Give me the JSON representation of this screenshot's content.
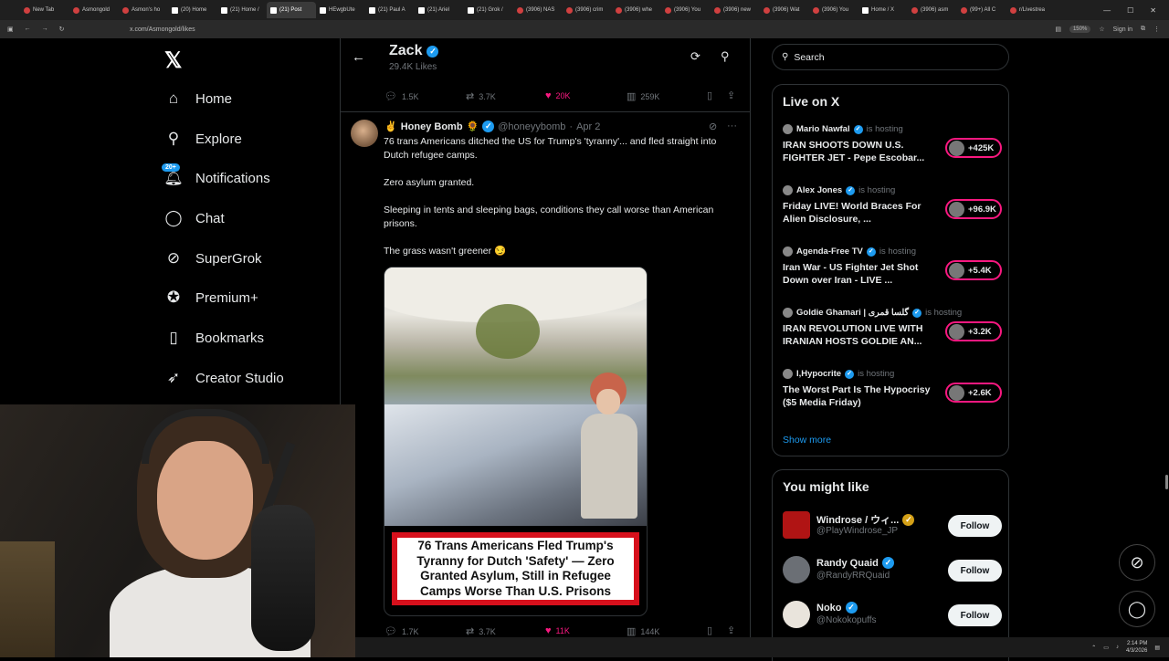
{
  "browser": {
    "tabs": [
      "New Tab",
      "Asmongold",
      "Asmon's ho",
      "(20) Home",
      "(21) Home /",
      "(21) Post",
      "HEwgbUte",
      "(21) Paul A",
      "(21) Ariel",
      "(21) Grok /",
      "(3906) NAS",
      "(3906) crim",
      "(3906) whe",
      "(3906) You",
      "(3906) new",
      "(3906) Wat",
      "(3906) You",
      "Home / X",
      "(3906) asm",
      "(99+) All C",
      "r/Livestrea"
    ],
    "url": "x.com/Asmongold/likes",
    "zoom": "150%",
    "signin_label": "Sign in"
  },
  "nav": {
    "items": [
      {
        "label": "Home",
        "icon": "home-icon"
      },
      {
        "label": "Explore",
        "icon": "search-icon"
      },
      {
        "label": "Notifications",
        "icon": "bell-icon",
        "badge": "20+"
      },
      {
        "label": "Chat",
        "icon": "chat-icon"
      },
      {
        "label": "SuperGrok",
        "icon": "grok-icon"
      },
      {
        "label": "Premium+",
        "icon": "premium-icon"
      },
      {
        "label": "Bookmarks",
        "icon": "bookmark-icon"
      },
      {
        "label": "Creator Studio",
        "icon": "rocket-icon"
      }
    ]
  },
  "header": {
    "name": "Zack",
    "likes": "29.4K Likes"
  },
  "prev_actions": {
    "replies": "1.5K",
    "reposts": "3.7K",
    "likes": "20K",
    "views": "259K"
  },
  "tweet": {
    "author": "Honey Bomb",
    "emoji_prefix": "✌",
    "emoji_suffix": "🌻",
    "handle": "@honeyybomb",
    "date": "Apr 2",
    "paragraphs": [
      "76 trans Americans ditched the US for Trump's 'tyranny'... and fled straight into Dutch refugee camps.",
      "Zero asylum granted.",
      "Sleeping in tents and sleeping bags, conditions they call worse than American prisons.",
      "The grass wasn't greener 😏"
    ],
    "image_caption": "76 Trans Americans Fled Trump's Tyranny for Dutch 'Safety' — Zero Granted Asylum, Still in Refugee Camps Worse Than U.S. Prisons",
    "actions": {
      "replies": "1.7K",
      "reposts": "3.7K",
      "likes": "11K",
      "views": "144K"
    }
  },
  "search": {
    "placeholder": "Search"
  },
  "live": {
    "title": "Live on X",
    "hosting_label": "is hosting",
    "items": [
      {
        "host": "Mario Nawfal",
        "title": "IRAN SHOOTS DOWN U.S. FIGHTER JET - Pepe Escobar...",
        "count": "+425K"
      },
      {
        "host": "Alex Jones",
        "title": "Friday LIVE! World Braces For Alien Disclosure, ...",
        "count": "+96.9K"
      },
      {
        "host": "Agenda-Free TV",
        "title": "Iran War - US Fighter Jet Shot Down over Iran - LIVE ...",
        "count": "+5.4K"
      },
      {
        "host": "Goldie Ghamari | گلسا قمری",
        "title": "IRAN REVOLUTION LIVE WITH IRANIAN HOSTS GOLDIE AN...",
        "count": "+3.2K"
      },
      {
        "host": "I,Hypocrite",
        "title": "The Worst Part Is The Hypocrisy ($5 Media Friday)",
        "count": "+2.6K"
      }
    ],
    "show_more": "Show more"
  },
  "suggest": {
    "title": "You might like",
    "follow_label": "Follow",
    "items": [
      {
        "name": "Windrose / ウィ...",
        "handle": "@PlayWindrose_JP"
      },
      {
        "name": "Randy Quaid",
        "handle": "@RandyRRQuaid"
      },
      {
        "name": "Noko",
        "handle": "@Nokokopuffs"
      }
    ]
  },
  "taskbar": {
    "time": "2:14 PM",
    "date": "4/3/2026"
  },
  "colors": {
    "accent": "#1d9bf0",
    "like": "#f91880",
    "background": "#000000",
    "border": "#2f3336",
    "muted": "#71767b"
  }
}
